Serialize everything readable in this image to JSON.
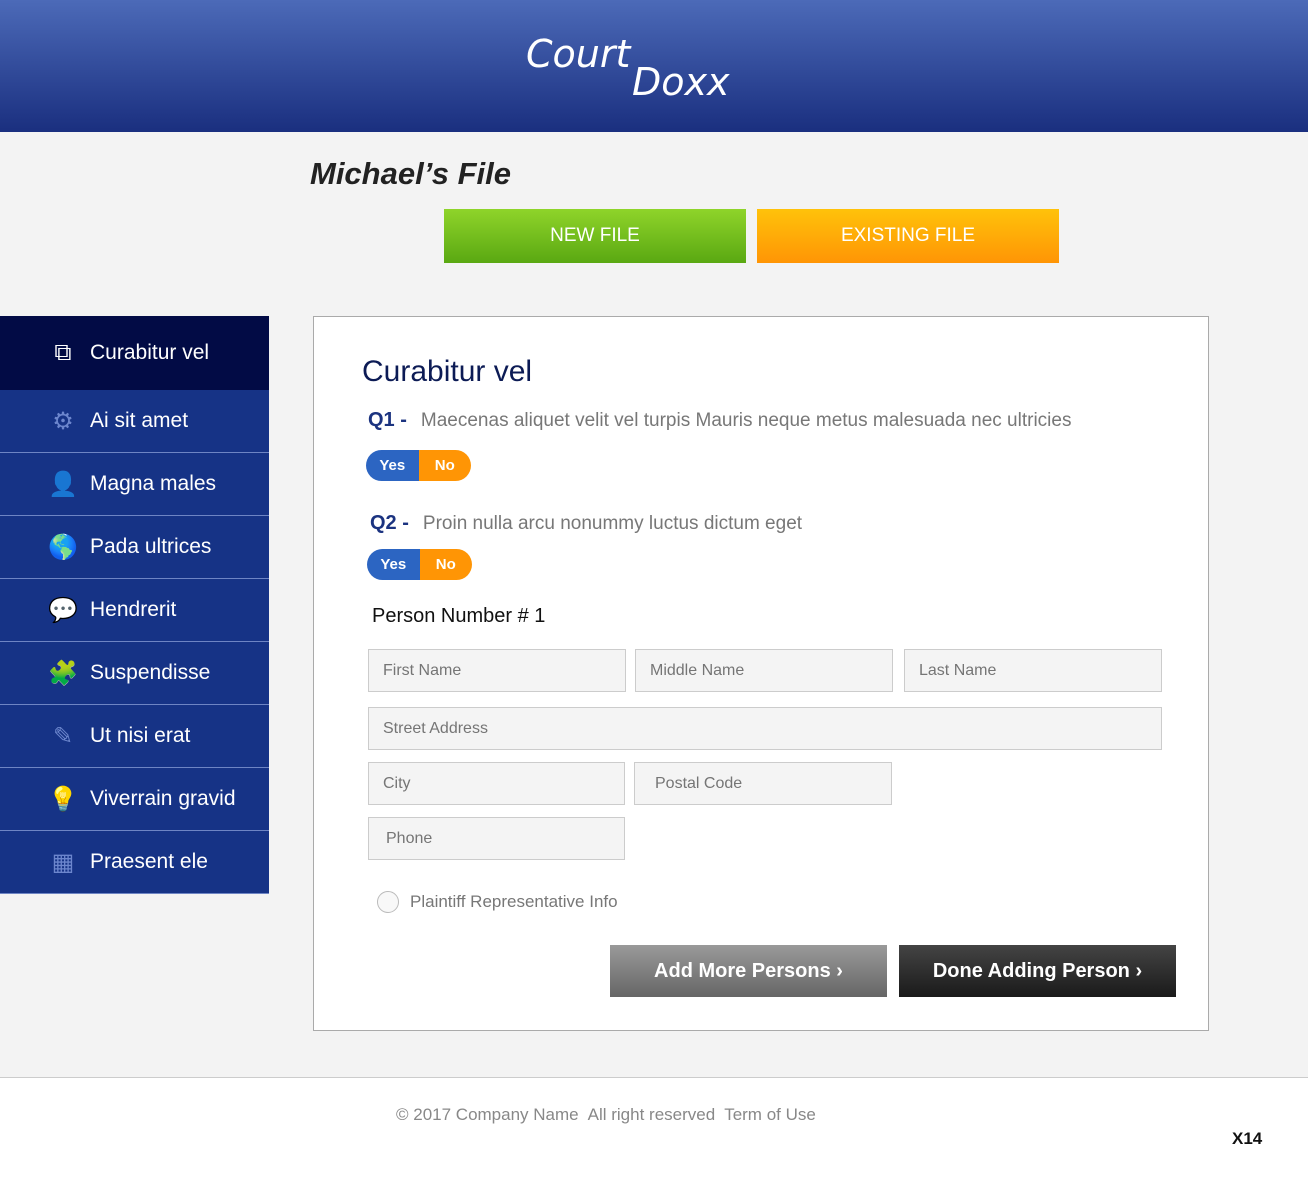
{
  "header": {
    "logo_line1": "Court",
    "logo_line2": "Doxx"
  },
  "page_title": "Michael’s File",
  "buttons": {
    "new_file": "NEW FILE",
    "existing_file": "EXISTING FILE",
    "add_more": "Add More Persons ›",
    "done": "Done Adding Person ›"
  },
  "sidebar": {
    "items": [
      {
        "label": "Curabitur vel",
        "icon": "documents-icon",
        "glyph": "⧉"
      },
      {
        "label": "Ai sit amet",
        "icon": "gear-icon",
        "glyph": "⚙"
      },
      {
        "label": "Magna males",
        "icon": "user-icon",
        "glyph": "👤"
      },
      {
        "label": "Pada ultrices",
        "icon": "globe-icon",
        "glyph": "🌎"
      },
      {
        "label": "Hendrerit",
        "icon": "chat-bubble-icon",
        "glyph": "💬"
      },
      {
        "label": "Suspendisse",
        "icon": "puzzle-icon",
        "glyph": "🧩"
      },
      {
        "label": "Ut nisi erat",
        "icon": "pencil-icon",
        "glyph": "✎"
      },
      {
        "label": "Viverrain gravid",
        "icon": "lightbulb-icon",
        "glyph": "💡"
      },
      {
        "label": "Praesent ele",
        "icon": "calendar-icon",
        "glyph": "▦"
      }
    ]
  },
  "form": {
    "heading": "Curabitur vel",
    "q1": {
      "label": "Q1 -",
      "text": "Maecenas aliquet velit vel turpis Mauris neque metus malesuada nec ultricies"
    },
    "q2": {
      "label": "Q2 -",
      "text": "Proin nulla arcu nonummy luctus dictum eget"
    },
    "yes": "Yes",
    "no": "No",
    "person": "Person Number # 1",
    "placeholders": {
      "first": "First Name",
      "middle": "Middle Name",
      "last": "Last Name",
      "street": "Street Address",
      "city": "City",
      "postal": "Postal Code",
      "phone": "Phone"
    },
    "radio_label": "Plaintiff Representative Info"
  },
  "footer": {
    "copyright": "© 2017 Company Name",
    "rights": "All right reserved",
    "terms": "Term of Use",
    "page_code": "X14"
  }
}
